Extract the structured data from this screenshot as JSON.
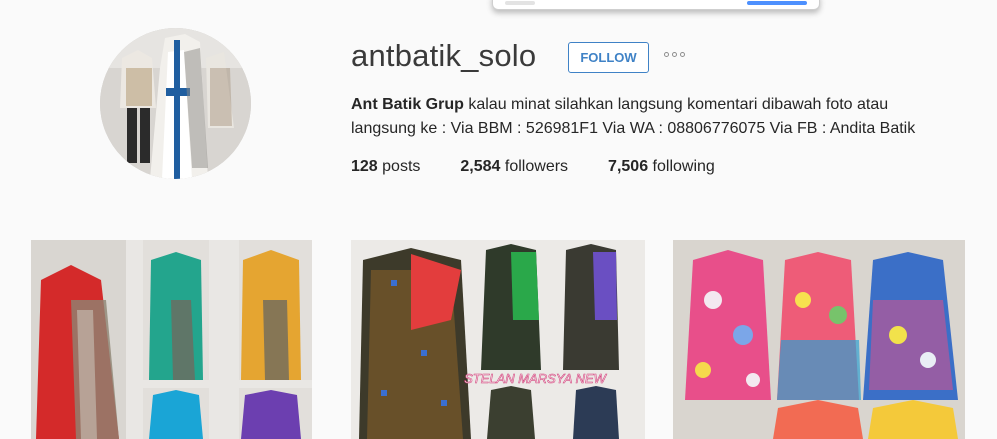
{
  "profile": {
    "username": "antbatik_solo",
    "follow_label": "FOLLOW",
    "more_label": "more options",
    "bio_name": "Ant Batik Grup",
    "bio_text": " kalau minat silahkan langsung komentari dibawah foto atau langsung ke : Via BBM : 526981F1 Via WA : 08806776075 Via FB : Andita Batik",
    "stats": {
      "posts_count": "128",
      "posts_label": "posts",
      "followers_count": "2,584",
      "followers_label": "followers",
      "following_count": "7,506",
      "following_label": "following"
    }
  },
  "grid": {
    "posts": [
      {
        "alt": "Red and green batik kebaya outfits on mannequins"
      },
      {
        "alt": "Batik outfits on mannequins",
        "caption": "STELAN MARSYA NEW"
      },
      {
        "alt": "Colorful batik sleeveless dresses on mannequins"
      }
    ]
  },
  "colors": {
    "accent": "#3f82c6",
    "background": "#fafafa",
    "text": "#262626"
  },
  "icons": {
    "more": "three-dots-icon"
  }
}
